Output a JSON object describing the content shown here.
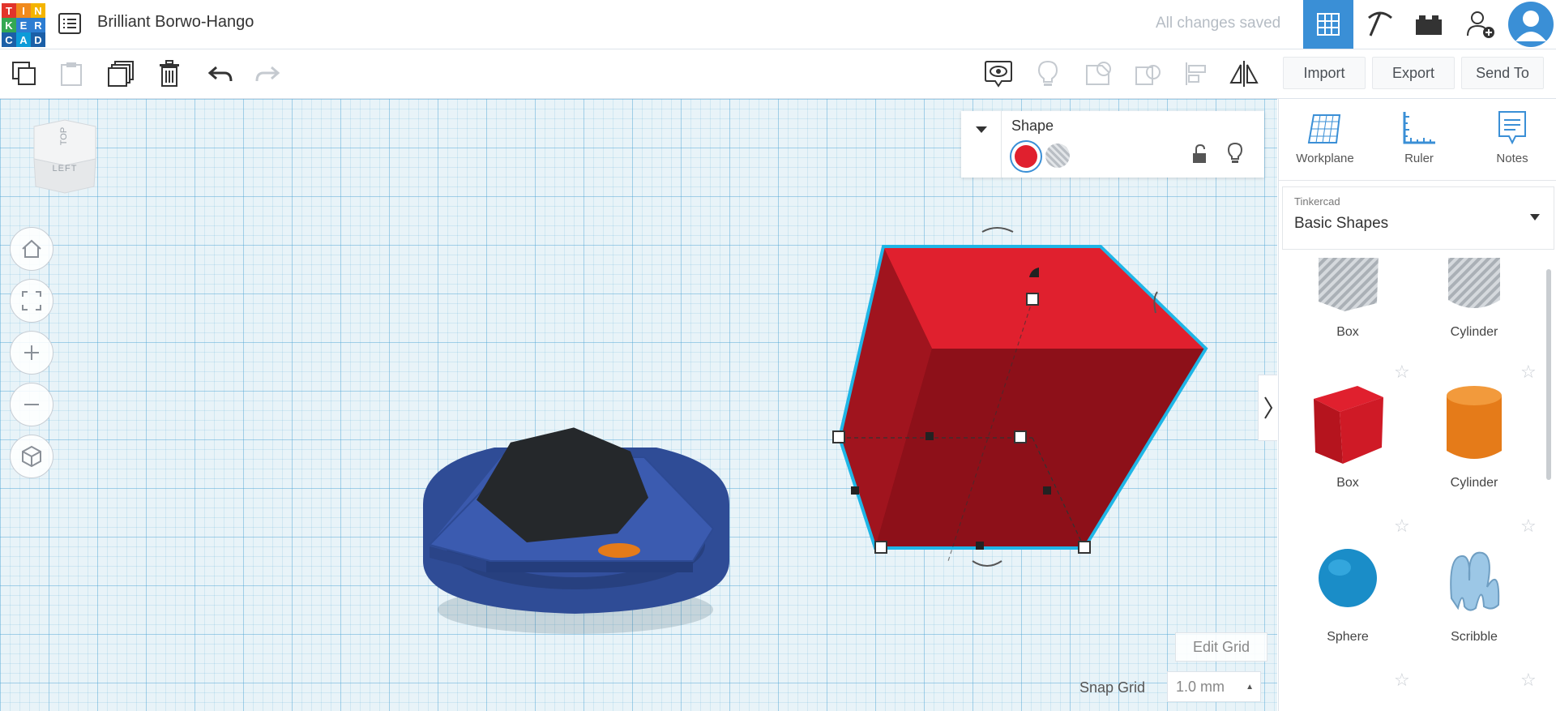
{
  "app": {
    "logo_letters": [
      "T",
      "I",
      "N",
      "K",
      "E",
      "R",
      "C",
      "A",
      "D"
    ],
    "logo_colors": [
      "#e2342b",
      "#f08a1d",
      "#f4b400",
      "#34a853",
      "#2d7dd2",
      "#2d7dd2",
      "#1b5fa7",
      "#0c9bd8",
      "#1b5fa7"
    ],
    "document_title": "Brilliant Borwo-Hango",
    "save_status": "All changes saved"
  },
  "topbar_icons": [
    "grid-view-icon",
    "pickaxe-icon",
    "bricks-icon",
    "add-user-icon",
    "avatar"
  ],
  "toolbar": {
    "import_label": "Import",
    "export_label": "Export",
    "send_to_label": "Send To"
  },
  "view_cube": {
    "top_label": "TOP",
    "front_label": "LEFT"
  },
  "shape_panel": {
    "title": "Shape",
    "solid_color": "#e0202e",
    "hole_label": "hole"
  },
  "right_panel": {
    "tools": [
      {
        "label": "Workplane"
      },
      {
        "label": "Ruler"
      },
      {
        "label": "Notes"
      }
    ],
    "library_group": "Tinkercad",
    "library_name": "Basic Shapes",
    "shapes": [
      {
        "label": "Box",
        "kind": "box-hole"
      },
      {
        "label": "Cylinder",
        "kind": "cylinder-hole"
      },
      {
        "label": "Box",
        "kind": "box"
      },
      {
        "label": "Cylinder",
        "kind": "cylinder"
      },
      {
        "label": "Sphere",
        "kind": "sphere"
      },
      {
        "label": "Scribble",
        "kind": "scribble"
      }
    ]
  },
  "grid_controls": {
    "edit_grid_label": "Edit Grid",
    "snap_grid_label": "Snap Grid",
    "snap_value": "1.0 mm"
  },
  "colors": {
    "accent_blue": "#3a8fd6",
    "workplane_bg": "#e8f3f8",
    "selection_outline": "#1fb6e6"
  }
}
